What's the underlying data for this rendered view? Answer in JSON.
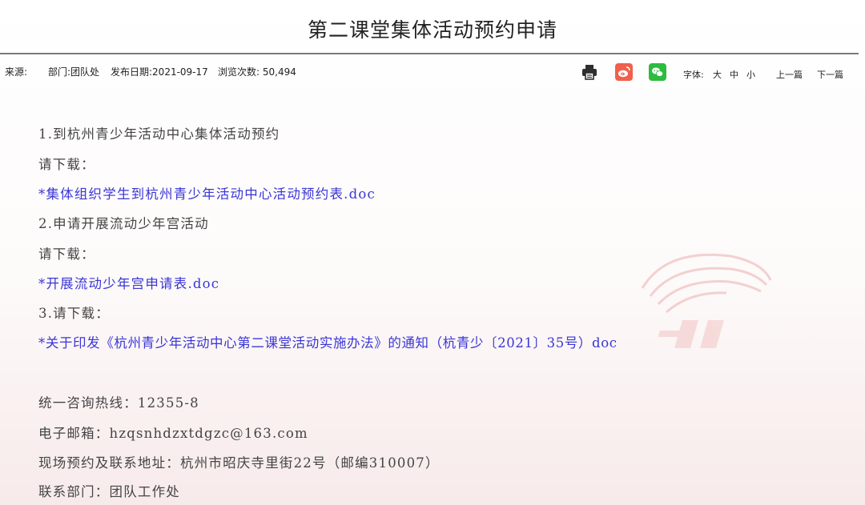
{
  "page": {
    "title": "第二课堂集体活动预约申请"
  },
  "meta": {
    "source_label": "来源:",
    "department": "部门:团队处",
    "publish_date": "发布日期:2021-09-17",
    "views": "浏览次数: 50,494"
  },
  "toolbar": {
    "icons": [
      "printer-icon",
      "weibo-icon",
      "wechat-icon"
    ],
    "font_label": "字体:",
    "font_large": "大",
    "font_medium": "中",
    "font_small": "小",
    "prev": "上一篇",
    "next": "下一篇"
  },
  "content": {
    "item1_heading": "1.到杭州青少年活动中心集体活动预约",
    "item1_prompt": "请下载：",
    "item1_link": "*集体组织学生到杭州青少年活动中心活动预约表.doc",
    "item2_heading": "2.申请开展流动少年宫活动",
    "item2_prompt": "请下载：",
    "item2_link": "*开展流动少年宫申请表.doc",
    "item3_heading": "3.请下载：",
    "item3_link": "*关于印发《杭州青少年活动中心第二课堂活动实施办法》的通知（杭青少〔2021〕35号）doc"
  },
  "contact": {
    "hotline": "统一咨询热线：12355-8",
    "email": "电子邮箱：hzqsnhdzxtdgzc@163.com",
    "address": "现场预约及联系地址：杭州市昭庆寺里街22号（邮编310007）",
    "department": "联系部门：团队工作处"
  },
  "colors": {
    "link": "#3a36d6",
    "weibo": "#f0604d",
    "wechat": "#2dbb40",
    "watermark": "#f2c9c9"
  }
}
